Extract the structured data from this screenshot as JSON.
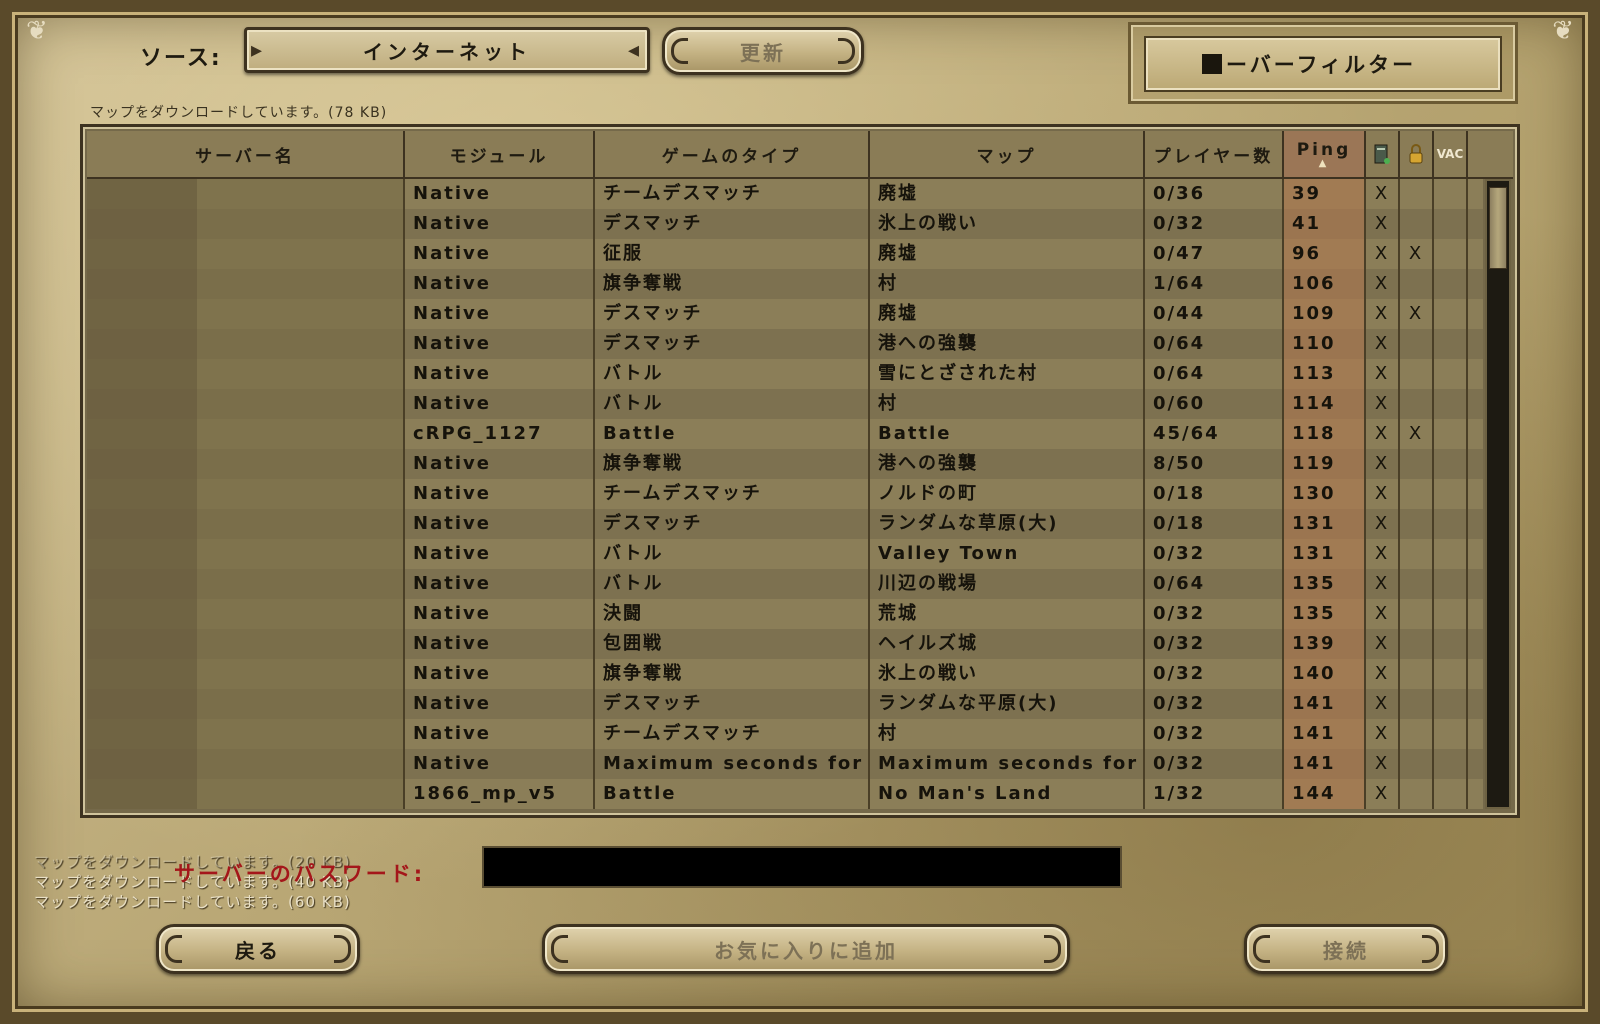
{
  "source": {
    "label": "ソース:",
    "selected": "インターネット",
    "refresh_label": "更新"
  },
  "filter": {
    "label": "サーバーフィルター"
  },
  "status": {
    "download": "マップをダウンロードしています。(78 KB)"
  },
  "table": {
    "headers": {
      "name": "サーバー名",
      "module": "モジュール",
      "gametype": "ゲームのタイプ",
      "map": "マップ",
      "players": "プレイヤー数",
      "ping": "Ping",
      "dedicated_icon": "server-icon",
      "password_icon": "lock-icon",
      "vac": "VAC"
    },
    "rows": [
      {
        "module": "Native",
        "gametype": "チームデスマッチ",
        "map": "廃墟",
        "players": "0/36",
        "ping": "39",
        "ded": "X",
        "pw": ""
      },
      {
        "module": "Native",
        "gametype": "デスマッチ",
        "map": "氷上の戦い",
        "players": "0/32",
        "ping": "41",
        "ded": "X",
        "pw": ""
      },
      {
        "module": "Native",
        "gametype": "征服",
        "map": "廃墟",
        "players": "0/47",
        "ping": "96",
        "ded": "X",
        "pw": "X"
      },
      {
        "module": "Native",
        "gametype": "旗争奪戦",
        "map": "村",
        "players": "1/64",
        "ping": "106",
        "ded": "X",
        "pw": ""
      },
      {
        "module": "Native",
        "gametype": "デスマッチ",
        "map": "廃墟",
        "players": "0/44",
        "ping": "109",
        "ded": "X",
        "pw": "X"
      },
      {
        "module": "Native",
        "gametype": "デスマッチ",
        "map": "港への強襲",
        "players": "0/64",
        "ping": "110",
        "ded": "X",
        "pw": ""
      },
      {
        "module": "Native",
        "gametype": "バトル",
        "map": "雪にとざされた村",
        "players": "0/64",
        "ping": "113",
        "ded": "X",
        "pw": ""
      },
      {
        "module": "Native",
        "gametype": "バトル",
        "map": "村",
        "players": "0/60",
        "ping": "114",
        "ded": "X",
        "pw": ""
      },
      {
        "module": "cRPG_1127",
        "gametype": "Battle",
        "map": "Battle",
        "players": "45/64",
        "ping": "118",
        "ded": "X",
        "pw": "X"
      },
      {
        "module": "Native",
        "gametype": "旗争奪戦",
        "map": "港への強襲",
        "players": "8/50",
        "ping": "119",
        "ded": "X",
        "pw": ""
      },
      {
        "module": "Native",
        "gametype": "チームデスマッチ",
        "map": "ノルドの町",
        "players": "0/18",
        "ping": "130",
        "ded": "X",
        "pw": ""
      },
      {
        "module": "Native",
        "gametype": "デスマッチ",
        "map": "ランダムな草原(大)",
        "players": "0/18",
        "ping": "131",
        "ded": "X",
        "pw": ""
      },
      {
        "module": "Native",
        "gametype": "バトル",
        "map": "Valley Town",
        "players": "0/32",
        "ping": "131",
        "ded": "X",
        "pw": ""
      },
      {
        "module": "Native",
        "gametype": "バトル",
        "map": "川辺の戦場",
        "players": "0/64",
        "ping": "135",
        "ded": "X",
        "pw": ""
      },
      {
        "module": "Native",
        "gametype": "決闘",
        "map": "荒城",
        "players": "0/32",
        "ping": "135",
        "ded": "X",
        "pw": ""
      },
      {
        "module": "Native",
        "gametype": "包囲戦",
        "map": "ヘイルズ城",
        "players": "0/32",
        "ping": "139",
        "ded": "X",
        "pw": ""
      },
      {
        "module": "Native",
        "gametype": "旗争奪戦",
        "map": "氷上の戦い",
        "players": "0/32",
        "ping": "140",
        "ded": "X",
        "pw": ""
      },
      {
        "module": "Native",
        "gametype": "デスマッチ",
        "map": "ランダムな平原(大)",
        "players": "0/32",
        "ping": "141",
        "ded": "X",
        "pw": ""
      },
      {
        "module": "Native",
        "gametype": "チームデスマッチ",
        "map": "村",
        "players": "0/32",
        "ping": "141",
        "ded": "X",
        "pw": ""
      },
      {
        "module": "Native",
        "gametype": "Maximum seconds for ...",
        "map": "Maximum seconds for ...",
        "players": "0/32",
        "ping": "141",
        "ded": "X",
        "pw": ""
      },
      {
        "module": "1866_mp_v5",
        "gametype": "Battle",
        "map": "No Man's Land",
        "players": "1/32",
        "ping": "144",
        "ded": "X",
        "pw": ""
      }
    ]
  },
  "log": {
    "faded_line": "マップをダウンロードしています。(20 KB)",
    "line2": "マップをダウンロードしています。(40 KB)",
    "line3": "マップをダウンロードしています。(60 KB)"
  },
  "password": {
    "label": "サーバーのパスワード:",
    "value": ""
  },
  "buttons": {
    "back": "戻る",
    "favorite": "お気に入りに追加",
    "connect": "接続"
  }
}
